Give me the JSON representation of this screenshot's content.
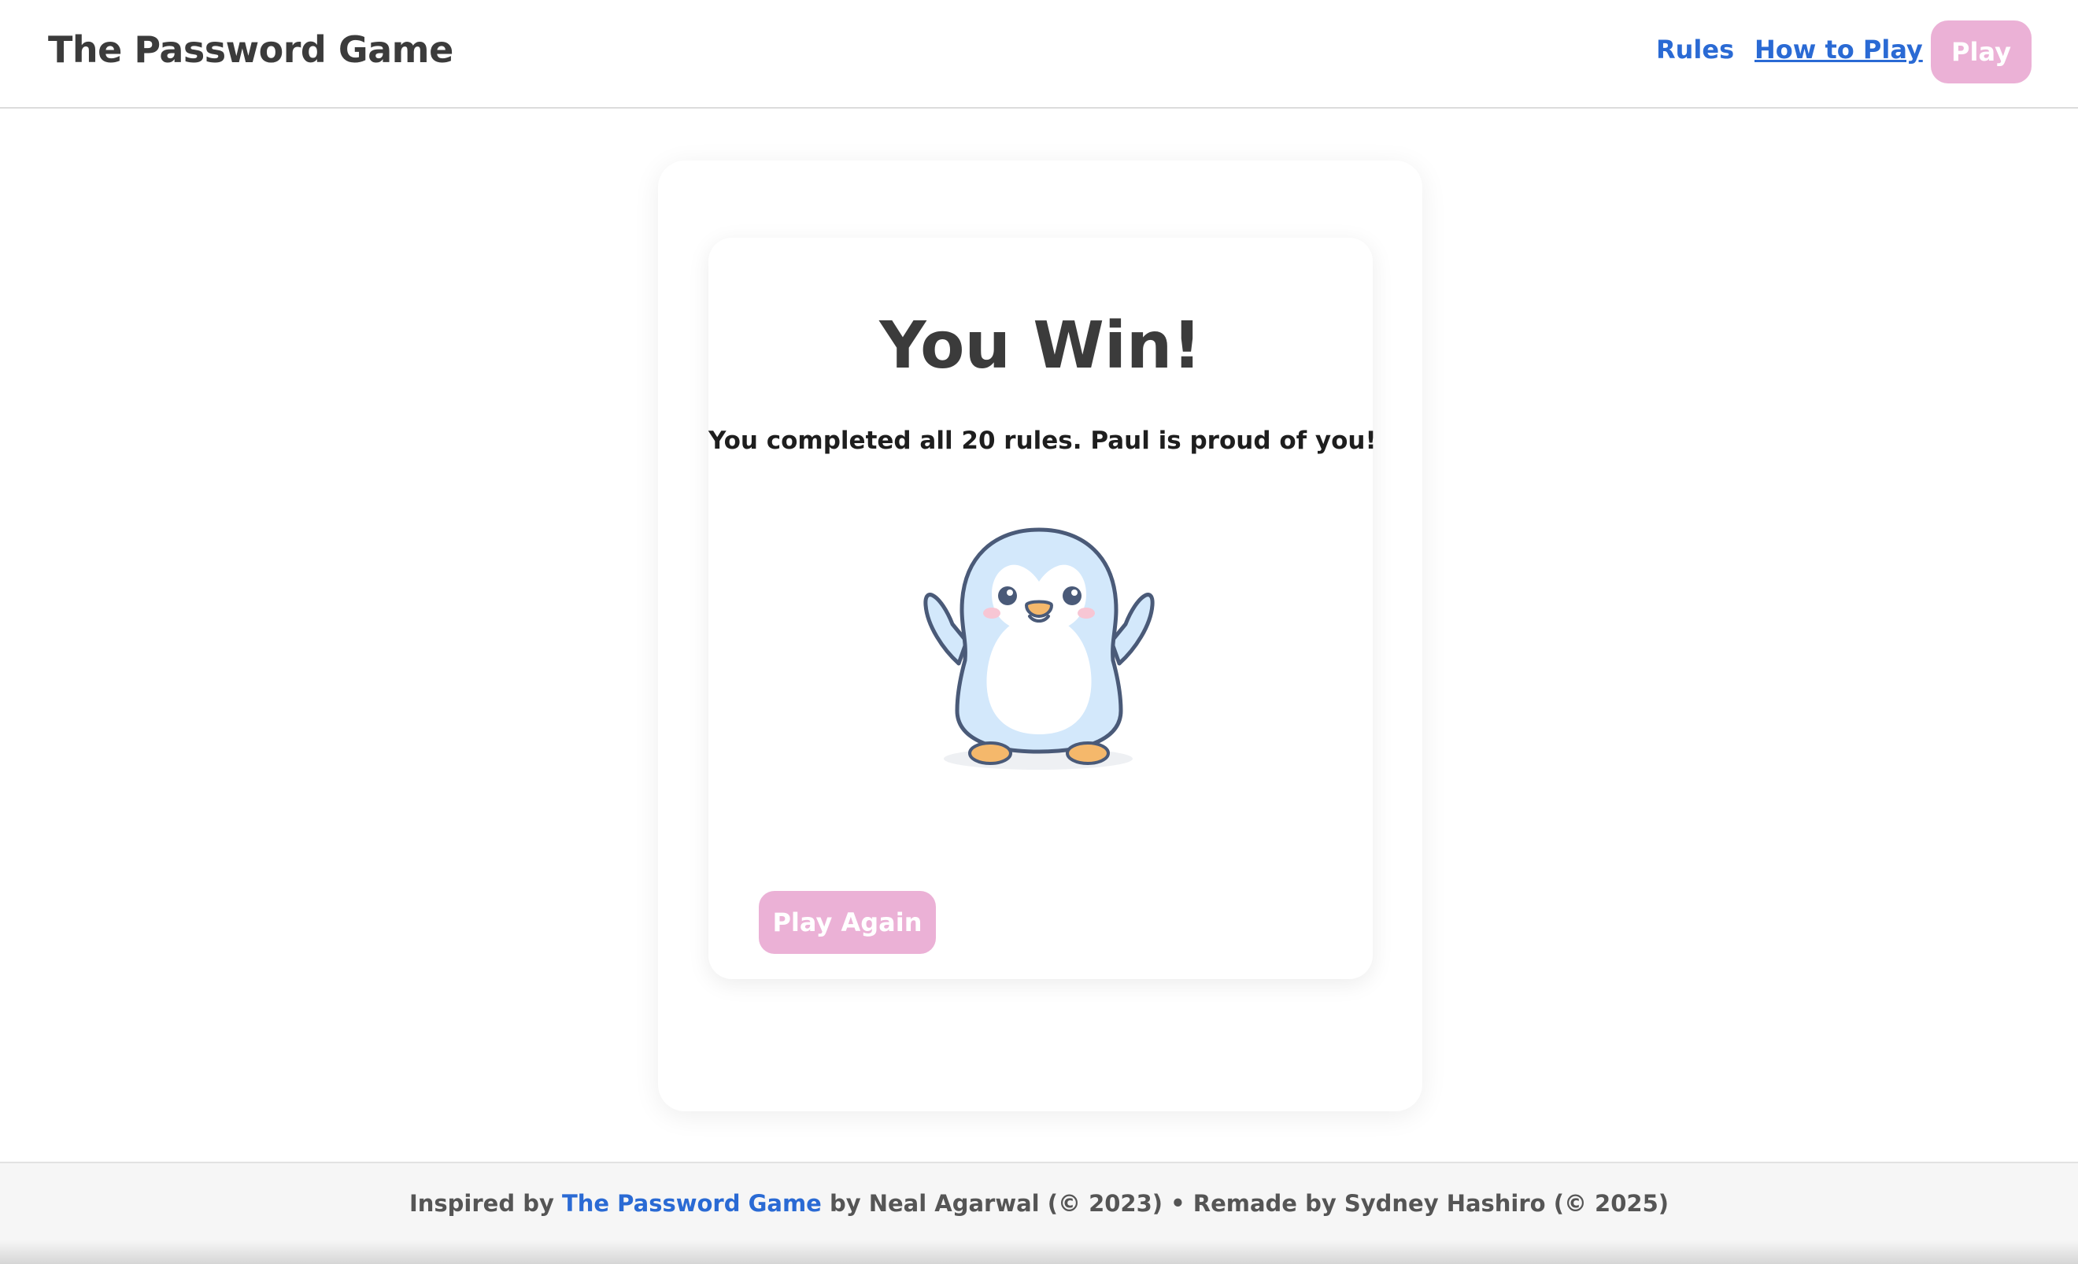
{
  "header": {
    "title": "The Password Game",
    "nav": {
      "rules": "Rules",
      "how_to_play": "How to Play",
      "play": "Play"
    }
  },
  "result": {
    "title": "You Win!",
    "message": "You completed all 20 rules. Paul is proud of you!",
    "play_again": "Play Again"
  },
  "footer": {
    "prefix": "Inspired by ",
    "link_text": "The Password Game",
    "suffix": " by Neal Agarwal (© 2023) • Remade by Sydney Hashiro (© 2025)"
  },
  "colors": {
    "accent_pink": "#ebb1d6",
    "link_blue": "#2a6ad4",
    "penguin_blue": "#d3e8fb",
    "penguin_outline": "#4a5a78",
    "penguin_feet": "#f5b86b"
  }
}
